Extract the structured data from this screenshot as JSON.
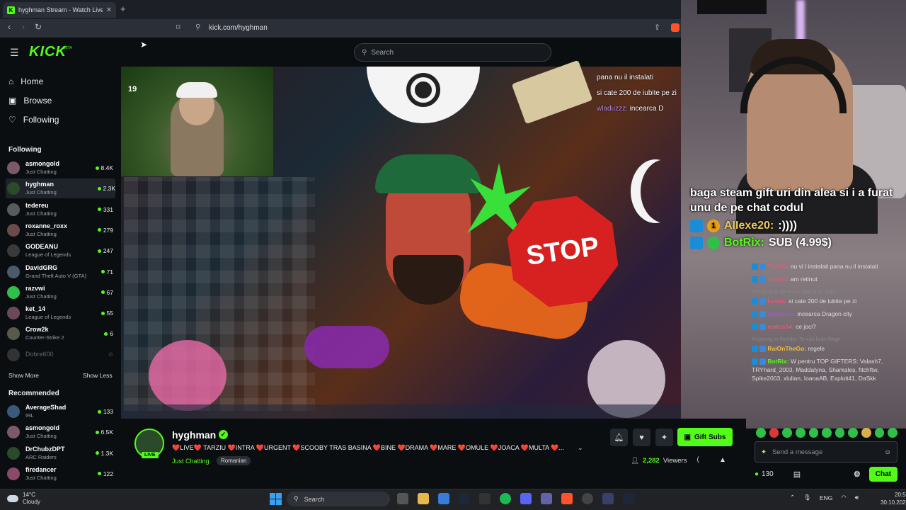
{
  "browser": {
    "tab_title": "hyghman Stream - Watch Live...",
    "url": "kick.com/hyghman"
  },
  "header": {
    "logo": "KICK",
    "beta": "BETA",
    "search_placeholder": "Search"
  },
  "sidebar": {
    "nav": [
      {
        "label": "Home",
        "icon": "home-icon"
      },
      {
        "label": "Browse",
        "icon": "browse-icon"
      },
      {
        "label": "Following",
        "icon": "heart-icon"
      }
    ],
    "following_title": "Following",
    "following": [
      {
        "name": "asmongold",
        "category": "Just Chatting",
        "viewers": "8.4K",
        "color": "#7a5a6a"
      },
      {
        "name": "hyghman",
        "category": "Just Chatting",
        "viewers": "2.3K",
        "color": "#2a4a2a"
      },
      {
        "name": "tedereu",
        "category": "Just Chatting",
        "viewers": "331",
        "color": "#5a5a5a"
      },
      {
        "name": "roxanne_roxx",
        "category": "Just Chatting",
        "viewers": "279",
        "color": "#6a4a4a"
      },
      {
        "name": "GODEANU",
        "category": "League of Legends",
        "viewers": "247",
        "color": "#3a3a3a"
      },
      {
        "name": "DavidGRG",
        "category": "Grand Theft Auto V (GTA)",
        "viewers": "71",
        "color": "#4a5a6a"
      },
      {
        "name": "razvwi",
        "category": "Just Chatting",
        "viewers": "67",
        "color": "#2fbf4a"
      },
      {
        "name": "ket_14",
        "category": "League of Legends",
        "viewers": "55",
        "color": "#6a4a5a"
      },
      {
        "name": "Crow2k",
        "category": "Counter-Strike 2",
        "viewers": "6",
        "color": "#5a5a4a"
      },
      {
        "name": "Dobre600",
        "category": "",
        "viewers": "",
        "color": "#333"
      }
    ],
    "show_more": "Show More",
    "show_less": "Show Less",
    "recommended_title": "Recommended",
    "recommended": [
      {
        "name": "AverageShad",
        "category": "IRL",
        "viewers": "133",
        "color": "#3a5a7a"
      },
      {
        "name": "asmongold",
        "category": "Just Chatting",
        "viewers": "6.5K",
        "color": "#7a5a6a"
      },
      {
        "name": "DrChubzDPT",
        "category": "ARC Raiders",
        "viewers": "1.3K",
        "color": "#2a4a2a"
      },
      {
        "name": "firedancer",
        "category": "Just Chatting",
        "viewers": "122",
        "color": "#8a4a6a"
      }
    ]
  },
  "overlay_chat": [
    {
      "user": "",
      "text": "pana nu il instalati"
    },
    {
      "user": "",
      "text": "si cate 200 de iubite pe zi"
    },
    {
      "user": "wladuzzz:",
      "text": "incearca D"
    }
  ],
  "cam_label": "19",
  "big_chat": {
    "message": "baga steam gift uri din alea si i a furat unu de pe chat codul",
    "row1_badge": "1",
    "row1_user": "AIIexe20:",
    "row1_text": ":))))",
    "row2_user": "BotRix:",
    "row2_text": "SUB (4.99$)"
  },
  "chat": {
    "messages": [
      {
        "reply": "",
        "user": "Tibo07:",
        "user_color": "#e05a7a",
        "text": "nu vi l instalati pana nu il instalati"
      },
      {
        "reply": "",
        "user": "Tibo07:",
        "user_color": "#e05a7a",
        "text": "am retinut"
      },
      {
        "reply": "Replying to deranaa: daa si cu aripi",
        "user": "Loskii:",
        "user_color": "#e05a7a",
        "text": "si cate 200 de iubite pe zi"
      },
      {
        "reply": "",
        "user": "wladuzzz:",
        "user_color": "#9b59d8",
        "text": "incearca Dragon city"
      },
      {
        "reply": "",
        "user": "andus14:",
        "user_color": "#e05a7a",
        "text": "ce joci?"
      },
      {
        "reply": "Replying to fitchftw: Te iubi bubi Rege",
        "user": "RaiOnTheGo:",
        "user_color": "#f0c040",
        "text": "regele"
      },
      {
        "reply": "",
        "user": "BotRix:",
        "user_color": "#53fc18",
        "text": "W pentru TOP GIFTERS: Valash7, TRYhard_2003, Maddalyna, Sharkales, fitchftw, Spike2003, xlulian, IoanaAB, Exploit41, DaSkk"
      }
    ],
    "input_placeholder": "Send a message",
    "points": "130",
    "chat_button": "Chat"
  },
  "stream": {
    "name": "hyghman",
    "live_label": "LIVE",
    "title": "❤️LIVE❤️ TARZIU ❤️INTRA ❤️URGENT ❤️SCOOBY TRAS BASINA ❤️BINE ❤️DRAMA ❤️MARE ❤️OMULE ❤️JOACA ❤️MULTA ❤️...",
    "category": "Just Chatting",
    "tag": "Romanian",
    "viewers": "2,282",
    "viewers_label": "Viewers",
    "gift_button": "Gift Subs"
  },
  "taskbar": {
    "temp": "14°C",
    "weather": "Cloudy",
    "search": "Search",
    "lang": "ENG",
    "time": "20:54",
    "date": "30.10.2025"
  },
  "colors": {
    "accent": "#53fc18",
    "background": "#0b0e11"
  }
}
